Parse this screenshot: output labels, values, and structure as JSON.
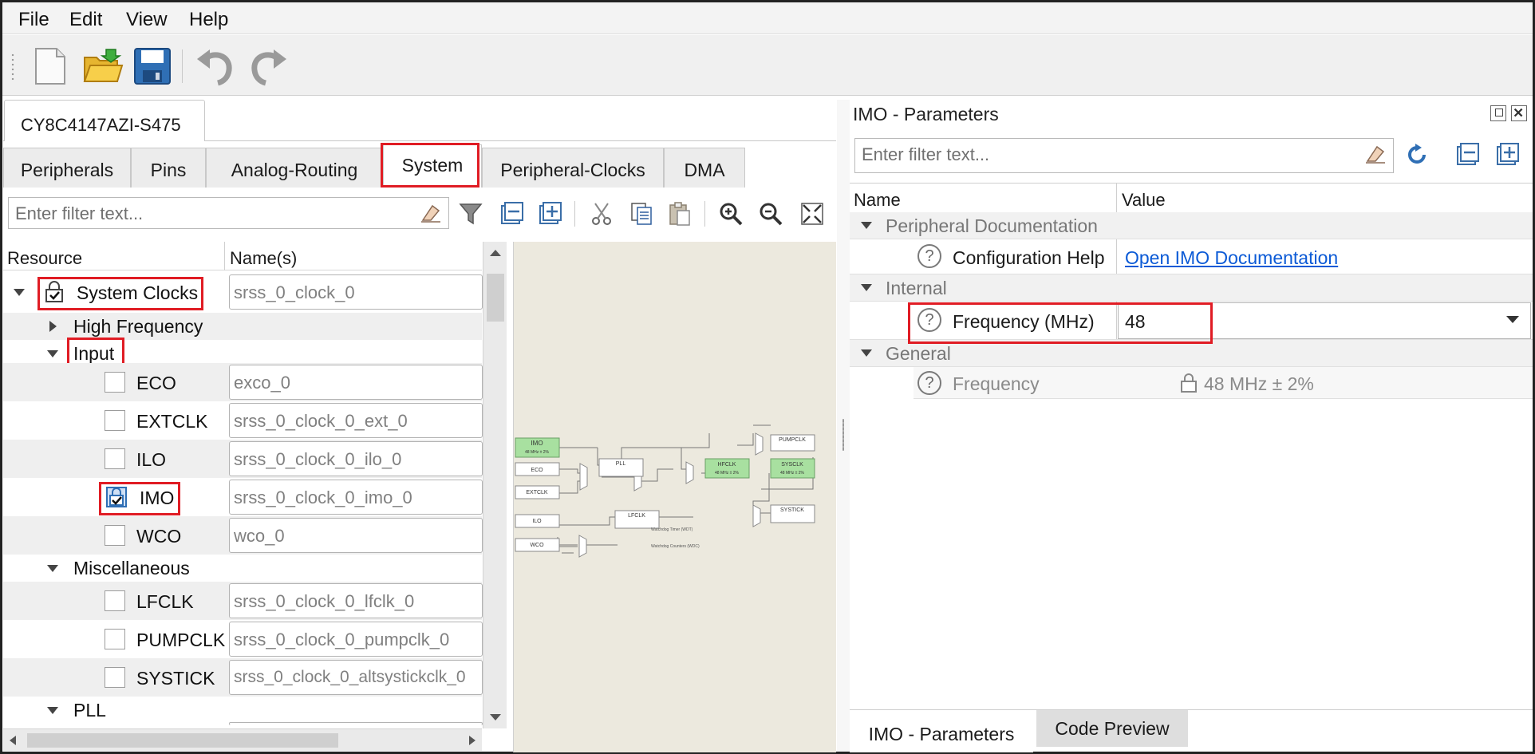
{
  "menu": {
    "file": "File",
    "edit": "Edit",
    "view": "View",
    "help": "Help"
  },
  "device_tab": "CY8C4147AZI-S475",
  "tabs": [
    "Peripherals",
    "Pins",
    "Analog-Routing",
    "System",
    "Peripheral-Clocks",
    "DMA"
  ],
  "left_filter_placeholder": "Enter filter text...",
  "tree_headers": {
    "resource": "Resource",
    "names": "Name(s)"
  },
  "tree": {
    "system_clocks": {
      "label": "System Clocks",
      "name": "srss_0_clock_0"
    },
    "high_frequency": "High Frequency",
    "input": "Input",
    "eco": {
      "label": "ECO",
      "name": "exco_0"
    },
    "extclk": {
      "label": "EXTCLK",
      "name": "srss_0_clock_0_ext_0"
    },
    "ilo": {
      "label": "ILO",
      "name": "srss_0_clock_0_ilo_0"
    },
    "imo": {
      "label": "IMO",
      "name": "srss_0_clock_0_imo_0"
    },
    "wco": {
      "label": "WCO",
      "name": "wco_0"
    },
    "miscellaneous": "Miscellaneous",
    "lfclk": {
      "label": "LFCLK",
      "name": "srss_0_clock_0_lfclk_0"
    },
    "pumpclk": {
      "label": "PUMPCLK",
      "name": "srss_0_clock_0_pumpclk_0"
    },
    "systick": {
      "label": "SYSTICK",
      "name": "srss_0_clock_0_altsystickclk_0"
    },
    "pll": "PLL"
  },
  "diagram": {
    "imo": "IMO",
    "imo_sub": "48 MHz ± 2%",
    "eco": "ECO",
    "extclk": "EXTCLK",
    "ilo": "ILO",
    "wco": "WCO",
    "pll": "PLL",
    "lfclk": "LFCLK",
    "hfclk": "HFCLK",
    "hfclk_sub": "48 MHz ± 2%",
    "pumpclk": "PUMPCLK",
    "sysclk": "SYSCLK",
    "sysclk_sub": "48 MHz ± 2%",
    "systick": "SYSTICK",
    "wdt": "Watchdog Timer (WDT)",
    "wdc": "Watchdog Counters (WDC)"
  },
  "right": {
    "title": "IMO - Parameters",
    "filter_placeholder": "Enter filter text...",
    "headers": {
      "name": "Name",
      "value": "Value"
    },
    "cat_peripheral_doc": "Peripheral Documentation",
    "config_help": "Configuration Help",
    "config_help_link": "Open IMO Documentation",
    "cat_internal": "Internal",
    "frequency_mhz": "Frequency (MHz)",
    "frequency_mhz_value": "48",
    "cat_general": "General",
    "frequency": "Frequency",
    "frequency_value": "48 MHz ± 2%"
  },
  "bottom_tabs": [
    "IMO - Parameters",
    "Code Preview"
  ],
  "colors": {
    "highlight_red": "#e01c24",
    "link_blue": "#0b5ad6",
    "diagram_bg": "#ece9de",
    "clock_green": "#a8e0a0"
  }
}
